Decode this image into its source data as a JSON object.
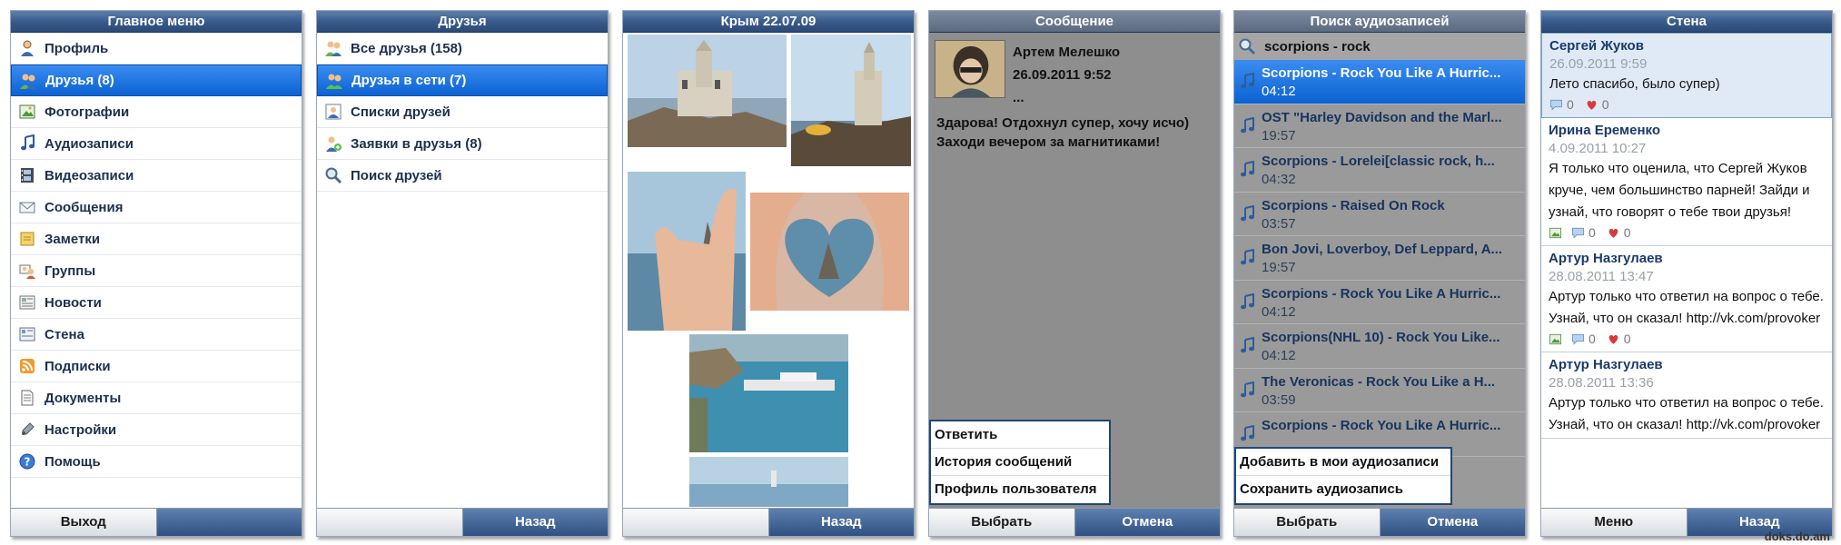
{
  "main_menu": {
    "title": "Главное меню",
    "items": [
      {
        "label": "Профиль",
        "icon": "profile-icon"
      },
      {
        "label": "Друзья (8)",
        "icon": "friends-icon",
        "selected": true
      },
      {
        "label": "Фотографии",
        "icon": "photos-icon"
      },
      {
        "label": "Аудиозаписи",
        "icon": "music-note-icon"
      },
      {
        "label": "Видеозаписи",
        "icon": "film-icon"
      },
      {
        "label": "Сообщения",
        "icon": "envelope-icon"
      },
      {
        "label": "Заметки",
        "icon": "note-icon"
      },
      {
        "label": "Группы",
        "icon": "groups-icon"
      },
      {
        "label": "Новости",
        "icon": "news-icon"
      },
      {
        "label": "Стена",
        "icon": "wall-icon"
      },
      {
        "label": "Подписки",
        "icon": "rss-icon"
      },
      {
        "label": "Документы",
        "icon": "document-icon"
      },
      {
        "label": "Настройки",
        "icon": "settings-icon"
      },
      {
        "label": "Помощь",
        "icon": "help-icon"
      }
    ],
    "softkeys": {
      "left": "Выход",
      "right": ""
    }
  },
  "friends": {
    "title": "Друзья",
    "items": [
      {
        "label": "Все друзья (158)",
        "icon": "all-friends-icon"
      },
      {
        "label": "Друзья в сети (7)",
        "icon": "online-friends-icon",
        "selected": true
      },
      {
        "label": "Списки друзей",
        "icon": "friend-lists-icon"
      },
      {
        "label": "Заявки в друзья (8)",
        "icon": "friend-requests-icon"
      },
      {
        "label": "Поиск друзей",
        "icon": "search-icon"
      }
    ],
    "softkeys": {
      "left": "",
      "right": "Назад"
    }
  },
  "album": {
    "title": "Крым 22.07.09",
    "softkeys": {
      "left": "",
      "right": "Назад"
    }
  },
  "message": {
    "title": "Сообщение",
    "author": "Артем Мелешко",
    "date": "26.09.2011 9:52",
    "ellipsis": "...",
    "body": "Здарова! Отдохнул супер, хочу исчо) Заходи вечером за магнитиками!",
    "menu": [
      "Ответить",
      "История сообщений",
      "Профиль пользователя"
    ],
    "softkeys": {
      "left": "Выбрать",
      "right": "Отмена"
    }
  },
  "audio": {
    "title": "Поиск аудиозаписей",
    "query": "scorpions - rock",
    "tracks": [
      {
        "title": "Scorpions - Rock You Like A Hurric...",
        "duration": "04:12",
        "selected": true
      },
      {
        "title": "OST \"Harley Davidson and the Marl...",
        "duration": "19:57"
      },
      {
        "title": "Scorpions - Lorelei[classic rock, h...",
        "duration": "04:32"
      },
      {
        "title": "Scorpions - Raised On Rock",
        "duration": "03:57"
      },
      {
        "title": "Bon Jovi, Loverboy, Def Leppard, A...",
        "duration": "19:57"
      },
      {
        "title": "Scorpions - Rock You Like A Hurric...",
        "duration": "04:12"
      },
      {
        "title": "Scorpions(NHL 10) - Rock You Like...",
        "duration": "04:12"
      },
      {
        "title": "The Veronicas - Rock You Like a H...",
        "duration": "03:59"
      },
      {
        "title": "Scorpions - Rock You Like A Hurric...",
        "duration": ""
      }
    ],
    "menu": [
      "Добавить в мои аудиозаписи",
      "Сохранить аудиозапись"
    ],
    "softkeys": {
      "left": "Выбрать",
      "right": "Отмена"
    }
  },
  "wall": {
    "title": "Стена",
    "posts": [
      {
        "author": "Сергей Жуков",
        "date": "26.09.2011 9:59",
        "text": "Лето спасибо, было супер)",
        "comments": "0",
        "likes": "0",
        "photo": false,
        "selected": true
      },
      {
        "author": "Ирина Еременко",
        "date": "4.09.2011 10:27",
        "text": "Я только что оценила, что Сергей Жуков круче, чем большинство парней! Зайди и узнай, что говорят о тебе твои друзья!",
        "comments": "0",
        "likes": "0",
        "photo": true
      },
      {
        "author": "Артур Назгулаев",
        "date": "28.08.2011 13:47",
        "text": "Артур только что ответил на вопрос о тебе. Узнай, что он сказал! http://vk.com/provoker",
        "comments": "0",
        "likes": "0",
        "photo": true
      },
      {
        "author": "Артур Назгулаев",
        "date": "28.08.2011 13:36",
        "text": "Артур только что ответил на вопрос о тебе. Узнай, что он сказал! http://vk.com/provoker",
        "comments": "",
        "likes": "",
        "photo": false
      }
    ],
    "softkeys": {
      "left": "Меню",
      "right": "Назад"
    }
  },
  "watermark": "doks.do.am"
}
